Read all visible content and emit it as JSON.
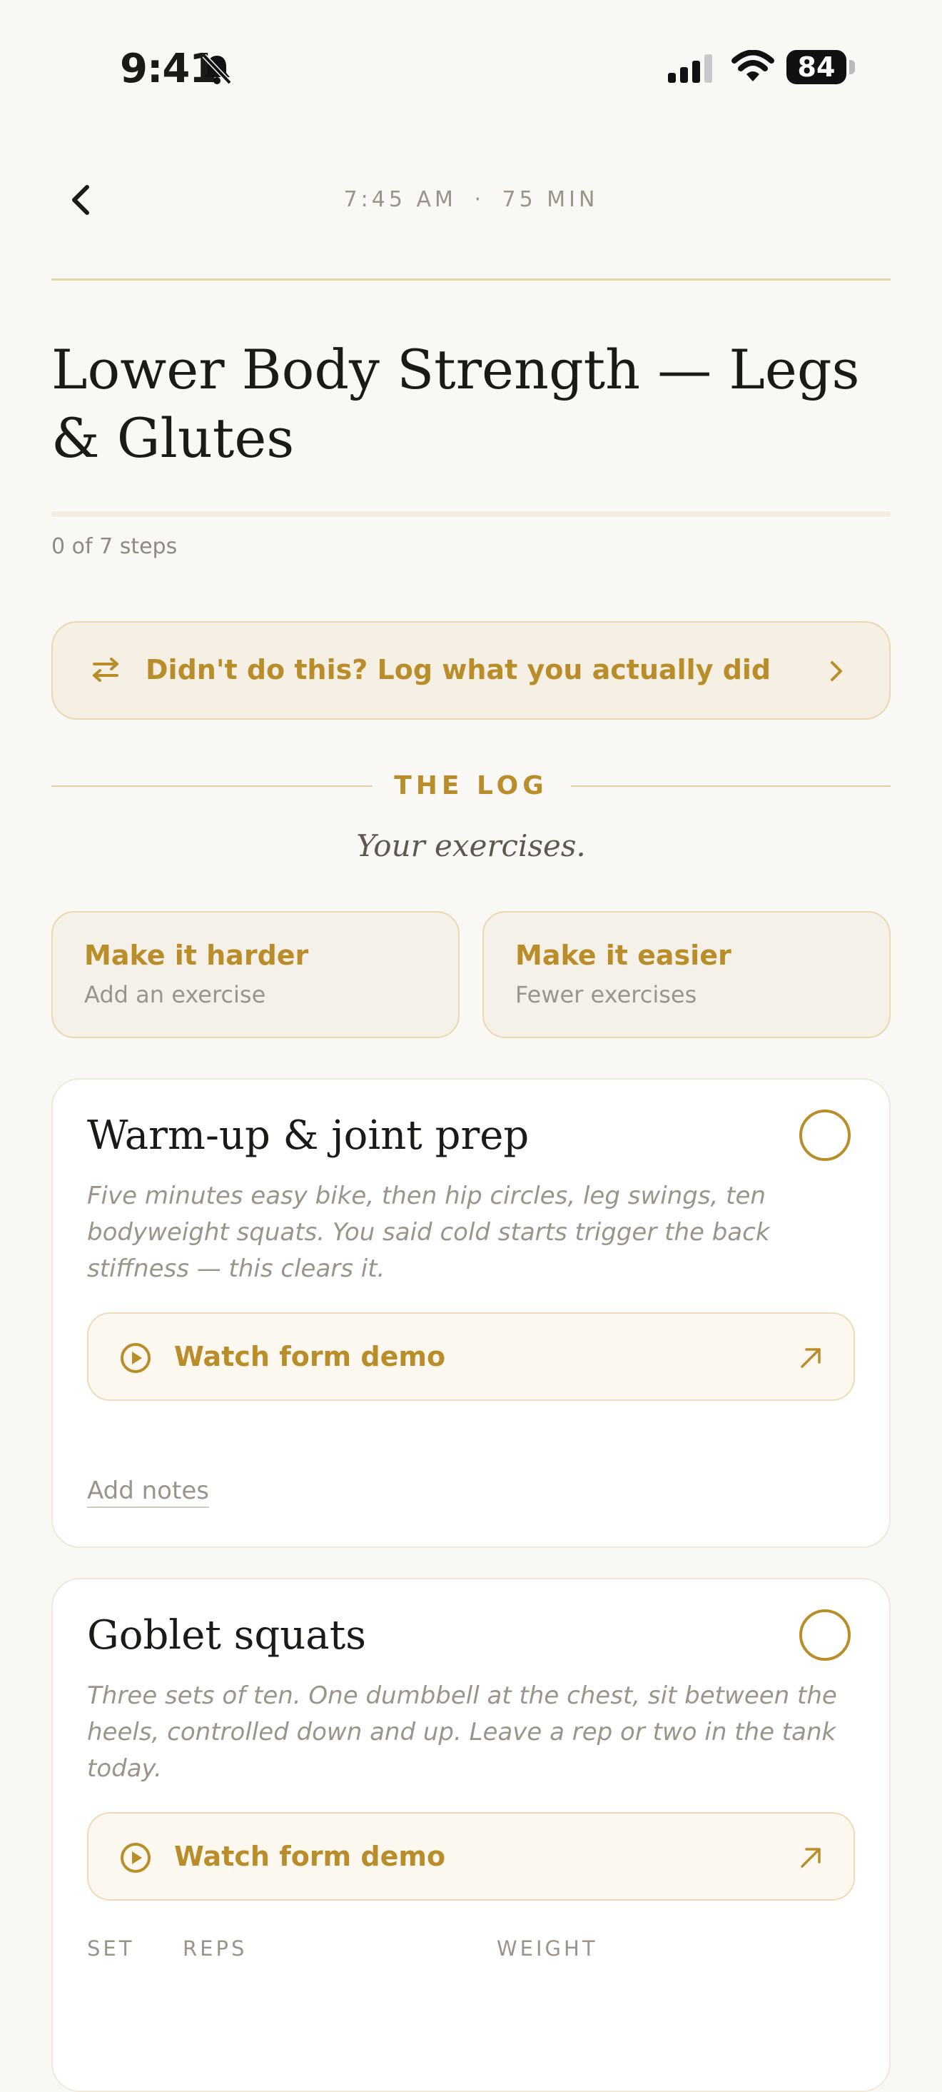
{
  "status_bar": {
    "time": "9:41",
    "battery": "84"
  },
  "header": {
    "time": "7:45 AM",
    "separator": "·",
    "duration": "75 MIN"
  },
  "workout": {
    "title": "Lower Body Strength — Legs & Glutes",
    "progress_text": "0 of 7 steps",
    "progress_fraction": 0
  },
  "log_banner": {
    "label": "Didn't do this? Log what you actually did"
  },
  "section": {
    "label": "THE LOG",
    "subtitle": "Your exercises."
  },
  "adjust": {
    "harder": {
      "title": "Make it harder",
      "subtitle": "Add an exercise"
    },
    "easier": {
      "title": "Make it easier",
      "subtitle": "Fewer exercises"
    }
  },
  "exercises": [
    {
      "title": "Warm-up & joint prep",
      "description": "Five minutes easy bike, then hip circles, leg swings, ten bodyweight squats. You said cold starts trigger the back stiffness — this clears it.",
      "demo_label": "Watch form demo",
      "notes_placeholder": "Add notes"
    },
    {
      "title": "Goblet squats",
      "description": "Three sets of ten. One dumbbell at the chest, sit between the heels, controlled down and up. Leave a rep or two in the tank today.",
      "demo_label": "Watch form demo",
      "columns": [
        "SET",
        "REPS",
        "WEIGHT"
      ]
    }
  ],
  "colors": {
    "accent": "#b98d2a",
    "background": "#faf8f4",
    "card": "#ffffff"
  }
}
